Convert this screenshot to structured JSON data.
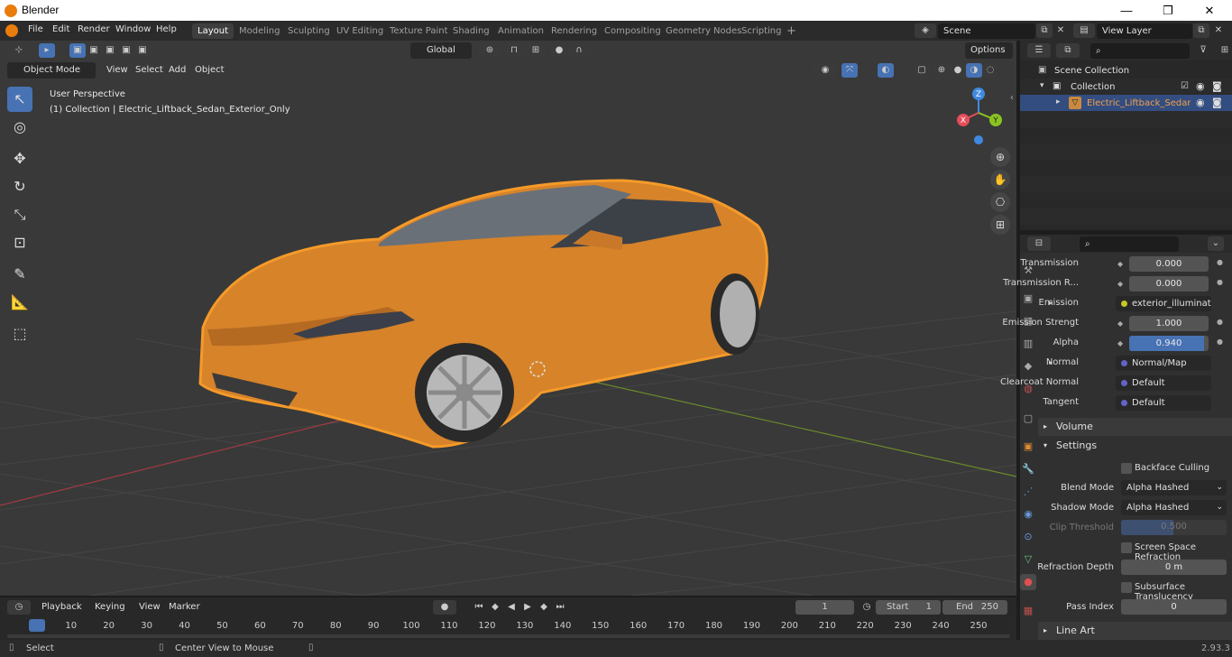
{
  "app": {
    "title": "Blender",
    "version": "2.93.3"
  },
  "window_controls": {
    "minimize": "—",
    "maximize": "❐",
    "close": "✕"
  },
  "menus": [
    "File",
    "Edit",
    "Render",
    "Window",
    "Help"
  ],
  "workspaces": [
    "Layout",
    "Modeling",
    "Sculpting",
    "UV Editing",
    "Texture Paint",
    "Shading",
    "Animation",
    "Rendering",
    "Compositing",
    "Geometry Nodes",
    "Scripting"
  ],
  "scene": {
    "name": "Scene",
    "view_layer": "View Layer"
  },
  "viewport_header": {
    "mode": "Object Mode",
    "menus": [
      "View",
      "Select",
      "Add",
      "Object"
    ],
    "transform": "Global",
    "options": "Options"
  },
  "viewport": {
    "perspective": "User Perspective",
    "collection_info": "(1) Collection | Electric_Liftback_Sedan_Exterior_Only"
  },
  "gizmo_axes": {
    "z": "Z",
    "x": "X",
    "y": "Y"
  },
  "outliner": {
    "root": "Scene Collection",
    "collection": "Collection",
    "object": "Electric_Liftback_Sedan_E"
  },
  "properties": {
    "rows": [
      {
        "label": "Transmission",
        "value": "0.000",
        "kind": "slider"
      },
      {
        "label": "Transmission R...",
        "value": "0.000",
        "kind": "slider"
      },
      {
        "label": "Emission",
        "value": "exterior_illumination...",
        "kind": "link"
      },
      {
        "label": "Emission Strengt",
        "value": "1.000",
        "kind": "slider"
      },
      {
        "label": "Alpha",
        "value": "0.940",
        "kind": "slider-blue",
        "fill": 0.94
      },
      {
        "label": "Normal",
        "value": "Normal/Map",
        "kind": "link"
      },
      {
        "label": "Clearcoat Normal",
        "value": "Default",
        "kind": "link"
      },
      {
        "label": "Tangent",
        "value": "Default",
        "kind": "link"
      }
    ],
    "volume": "Volume",
    "settings": "Settings",
    "backface_culling": "Backface Culling",
    "blend_mode_label": "Blend Mode",
    "blend_mode": "Alpha Hashed",
    "shadow_mode_label": "Shadow Mode",
    "shadow_mode": "Alpha Hashed",
    "clip_label": "Clip Threshold",
    "clip_value": "0.500",
    "ssr": "Screen Space Refraction",
    "refraction_depth_label": "Refraction Depth",
    "refraction_depth": "0 m",
    "subsurface": "Subsurface Translucency",
    "pass_index_label": "Pass Index",
    "pass_index": "0",
    "line_art": "Line Art"
  },
  "timeline": {
    "menus": [
      "Playback",
      "Keying",
      "View",
      "Marker"
    ],
    "current_frame": "1",
    "start_label": "Start",
    "start": "1",
    "end_label": "End",
    "end": "250",
    "ticks": [
      "1",
      "10",
      "20",
      "30",
      "40",
      "50",
      "60",
      "70",
      "80",
      "90",
      "100",
      "110",
      "120",
      "130",
      "140",
      "150",
      "160",
      "170",
      "180",
      "190",
      "200",
      "210",
      "220",
      "230",
      "240",
      "250"
    ]
  },
  "status": {
    "left": "Select",
    "middle": "Center View to Mouse"
  },
  "colors": {
    "accent": "#4772b3",
    "orange": "#e87d0d",
    "x_axis": "#e54d5a",
    "y_axis": "#8ac420",
    "z_axis": "#3f8ae0"
  }
}
